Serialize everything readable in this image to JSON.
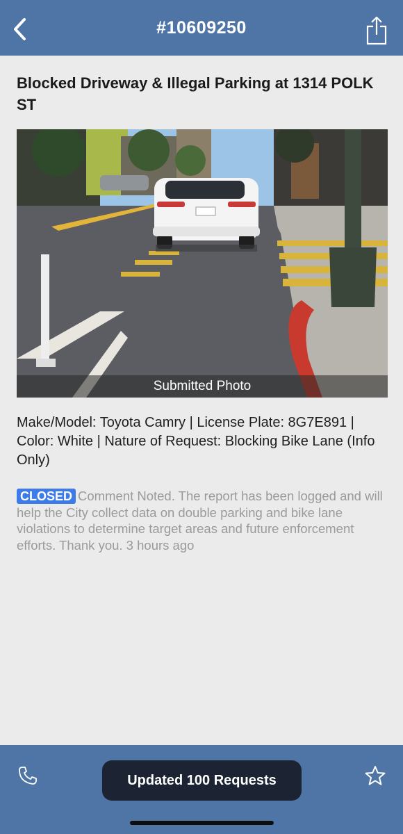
{
  "header": {
    "title": "#10609250"
  },
  "report": {
    "title": "Blocked Driveway & Illegal Parking at 1314 POLK ST",
    "photo_caption": "Submitted Photo",
    "details": "Make/Model: Toyota Camry | License Plate: 8G7E891 | Color: White | Nature of Request: Blocking Bike Lane (Info Only)",
    "status": {
      "badge": "CLOSED",
      "badge_color": "#3d7ce8",
      "comment": "Comment Noted. The report has been logged and will help the City collect data on double parking and bike lane violations to determine target areas and future enforcement efforts. Thank you. 3 hours ago"
    }
  },
  "footer": {
    "toast": "Updated 100 Requests"
  },
  "icons": {
    "back": "chevron-left-icon",
    "share": "share-icon",
    "phone": "phone-icon",
    "favorite": "star-icon"
  },
  "colors": {
    "bar": "#4f75a6",
    "background": "#ebebeb",
    "toast": "#1c2433"
  }
}
